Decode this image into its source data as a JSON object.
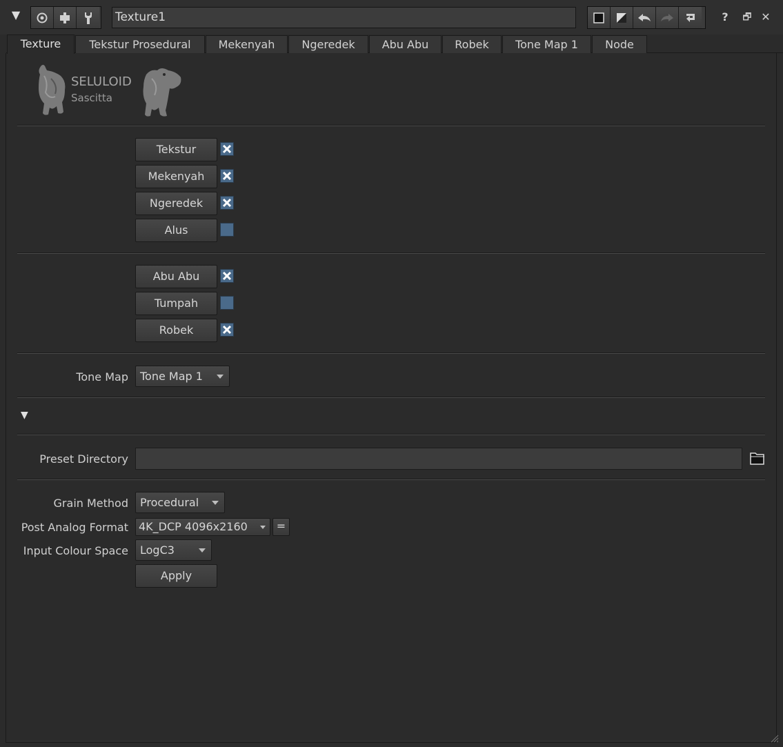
{
  "toolbar": {
    "node_name": "Texture1",
    "help_label": "?",
    "float_label": "🗗",
    "close_label": "✕",
    "collapse_glyph": "▼"
  },
  "tabs": [
    {
      "label": "Texture",
      "active": true
    },
    {
      "label": "Tekstur Prosedural"
    },
    {
      "label": "Mekenyah"
    },
    {
      "label": "Ngeredek"
    },
    {
      "label": "Abu Abu"
    },
    {
      "label": "Robek"
    },
    {
      "label": "Tone Map 1"
    },
    {
      "label": "Node"
    }
  ],
  "logo": {
    "title": "SELULOID",
    "subtitle": "Sascitta"
  },
  "group1": [
    {
      "label": "Tekstur",
      "checked": true
    },
    {
      "label": "Mekenyah",
      "checked": true
    },
    {
      "label": "Ngeredek",
      "checked": true
    },
    {
      "label": "Alus",
      "checked": false
    }
  ],
  "group2": [
    {
      "label": "Abu Abu",
      "checked": true
    },
    {
      "label": "Tumpah",
      "checked": false
    },
    {
      "label": "Robek",
      "checked": true
    }
  ],
  "tone_map": {
    "label": "Tone Map",
    "value": "Tone Map 1"
  },
  "section_toggle": "▼",
  "preset": {
    "label": "Preset Directory",
    "value": ""
  },
  "grain_method": {
    "label": "Grain Method",
    "value": "Procedural"
  },
  "post_format": {
    "label": "Post Analog Format",
    "value": "4K_DCP 4096x2160",
    "extra_button": "="
  },
  "colour_space": {
    "label": "Input Colour Space",
    "value": "LogC3"
  },
  "apply_label": "Apply",
  "colors": {
    "background": "#2b2b2b",
    "checkbox": "#4a6a8a",
    "text": "#d0d0d0"
  }
}
